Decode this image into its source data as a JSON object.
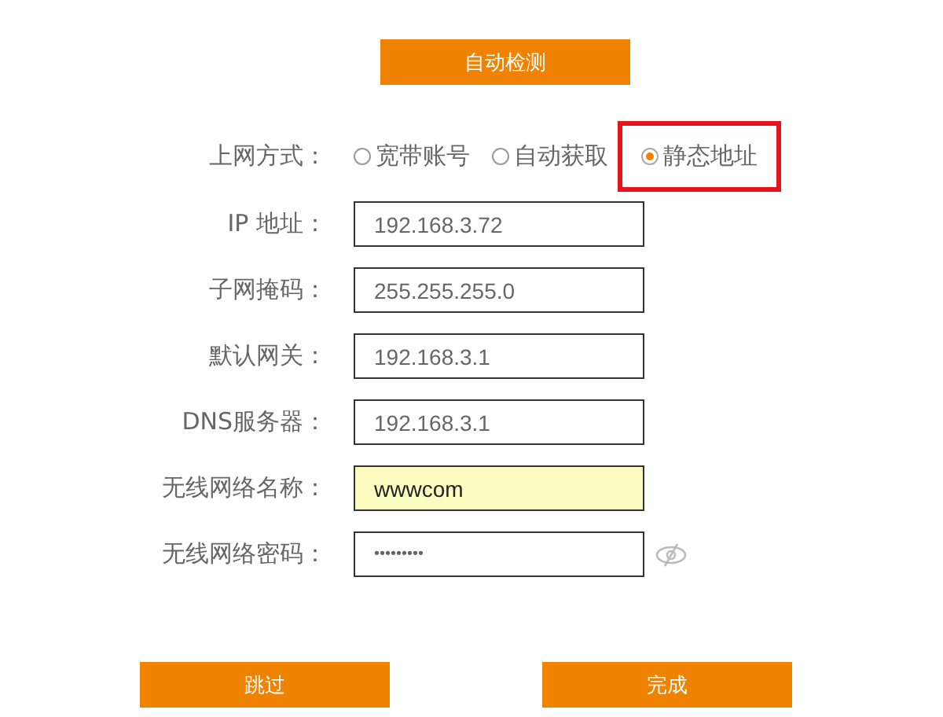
{
  "detect_button": "自动检测",
  "connection_type": {
    "label": "上网方式：",
    "options": [
      {
        "label": "宽带账号",
        "selected": false,
        "highlighted": false
      },
      {
        "label": "自动获取",
        "selected": false,
        "highlighted": false
      },
      {
        "label": "静态地址",
        "selected": true,
        "highlighted": true
      }
    ]
  },
  "fields": [
    {
      "label": "IP 地址：",
      "value": "192.168.3.72",
      "kind": "text",
      "highlighted": false
    },
    {
      "label": "子网掩码：",
      "value": "255.255.255.0",
      "kind": "text",
      "highlighted": false
    },
    {
      "label": "默认网关：",
      "value": "192.168.3.1",
      "kind": "text",
      "highlighted": false
    },
    {
      "label": "DNS服务器：",
      "value": "192.168.3.1",
      "kind": "text",
      "highlighted": false
    },
    {
      "label": "无线网络名称：",
      "value": "wwwcom",
      "kind": "text",
      "highlighted": true
    },
    {
      "label": "无线网络密码：",
      "value": "•••••••••",
      "kind": "password",
      "highlighted": false
    }
  ],
  "buttons": [
    "跳过",
    "完成"
  ]
}
